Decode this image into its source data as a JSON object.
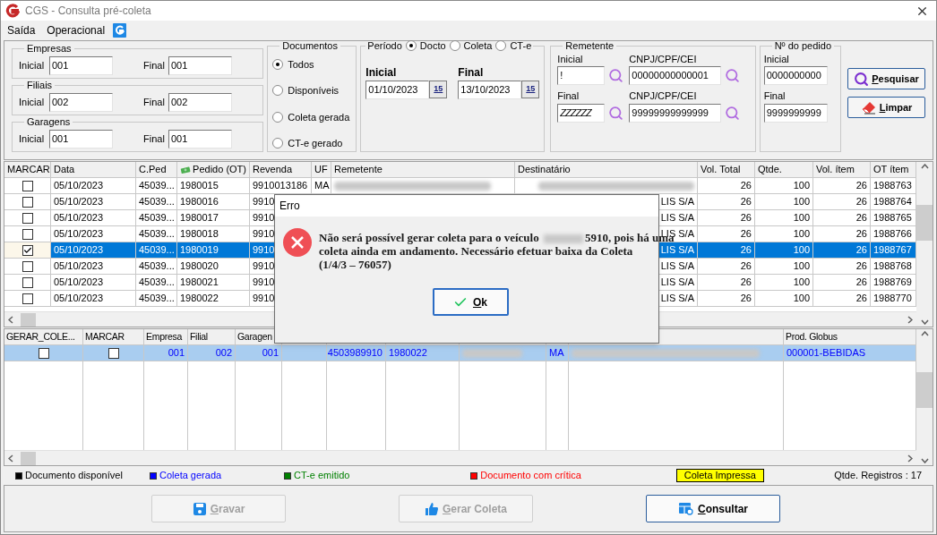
{
  "window": {
    "title": "CGS - Consulta pré-coleta"
  },
  "menu": [
    "Saída",
    "Operacional"
  ],
  "ranges": [
    {
      "label": "Empresas",
      "initial_label": "Inicial",
      "initial": "001",
      "final_label": "Final",
      "final": "001"
    },
    {
      "label": "Filiais",
      "initial_label": "Inicial",
      "initial": "002",
      "final_label": "Final",
      "final": "002"
    },
    {
      "label": "Garagens",
      "initial_label": "Inicial",
      "initial": "001",
      "final_label": "Final",
      "final": "001"
    }
  ],
  "documentos": {
    "label": "Documentos",
    "options": [
      {
        "label": "Todos",
        "selected": true
      },
      {
        "label": "Disponíveis",
        "selected": false
      },
      {
        "label": "Coleta gerada",
        "selected": false
      },
      {
        "label": "CT-e gerado",
        "selected": false
      }
    ]
  },
  "periodo": {
    "label": "Período",
    "options": [
      {
        "label": "Docto",
        "selected": true
      },
      {
        "label": "Coleta",
        "selected": false
      },
      {
        "label": "CT-e",
        "selected": false
      }
    ],
    "dates": [
      {
        "label": "Inicial",
        "value": "01/10/2023",
        "calendar": "15"
      },
      {
        "label": "Final",
        "value": "13/10/2023",
        "calendar": "15"
      }
    ]
  },
  "remetente": {
    "label": "Remetente",
    "rows": [
      {
        "label": "Inicial",
        "value": "!",
        "doc_label": "CNPJ/CPF/CEI",
        "doc": "00000000000001"
      },
      {
        "label": "Final",
        "value": "ZZZZZZ",
        "doc_label": "CNPJ/CPF/CEI",
        "doc": "99999999999999"
      }
    ]
  },
  "pedido": {
    "label": "Nº do pedido",
    "rows": [
      {
        "label": "Inicial",
        "value": "0000000000"
      },
      {
        "label": "Final",
        "value": "9999999999"
      }
    ]
  },
  "actions": [
    {
      "kind": "search",
      "label": "Pesquisar"
    },
    {
      "kind": "clear",
      "label": "Limpar"
    }
  ],
  "table": {
    "columns": [
      "MARCAR",
      "Data",
      "C.Ped",
      "Pedido (OT)",
      "Revenda",
      "UF",
      "Remetente",
      "Destinatário",
      "Vol. Total",
      "Qtde.",
      "Vol. ítem",
      "OT ítem"
    ],
    "rows": [
      {
        "selected": false,
        "cells": [
          {
            "checked": false
          },
          "05/10/2023",
          "45039...",
          "1980015",
          "9910013186",
          "MA",
          {
            "redacted": true
          },
          {
            "redacted": true
          },
          "26",
          "100",
          "26",
          "1988763"
        ]
      },
      {
        "selected": false,
        "cells": [
          {
            "checked": false
          },
          "05/10/2023",
          "45039...",
          "1980016",
          "9910",
          null,
          null,
          "LIS S/A",
          "26",
          "100",
          "26",
          "1988764"
        ]
      },
      {
        "selected": false,
        "cells": [
          {
            "checked": false
          },
          "05/10/2023",
          "45039...",
          "1980017",
          "9910",
          null,
          null,
          "LIS S/A",
          "26",
          "100",
          "26",
          "1988765"
        ]
      },
      {
        "selected": false,
        "cells": [
          {
            "checked": false
          },
          "05/10/2023",
          "45039...",
          "1980018",
          "9910",
          null,
          null,
          "LIS S/A",
          "26",
          "100",
          "26",
          "1988766"
        ]
      },
      {
        "selected": true,
        "cells": [
          {
            "checked": true
          },
          "05/10/2023",
          "45039...",
          "1980019",
          "9910",
          null,
          null,
          "LIS S/A",
          "26",
          "100",
          "26",
          "1988767"
        ]
      },
      {
        "selected": false,
        "cells": [
          {
            "checked": false
          },
          "05/10/2023",
          "45039...",
          "1980020",
          "9910",
          null,
          null,
          "LIS S/A",
          "26",
          "100",
          "26",
          "1988768"
        ]
      },
      {
        "selected": false,
        "cells": [
          {
            "checked": false
          },
          "05/10/2023",
          "45039...",
          "1980021",
          "9910",
          null,
          null,
          "LIS S/A",
          "26",
          "100",
          "26",
          "1988769"
        ]
      },
      {
        "selected": false,
        "cells": [
          {
            "checked": false
          },
          "05/10/2023",
          "45039...",
          "1980022",
          "9910",
          null,
          null,
          "LIS S/A",
          "26",
          "100",
          "26",
          "1988770"
        ]
      }
    ]
  },
  "table2": {
    "columns": [
      "GERAR_COLE...",
      "MARCAR",
      "Empresa",
      "Filial",
      "Garagen",
      null,
      null,
      null,
      null,
      null,
      null,
      "Prod. Globus"
    ],
    "rows": [
      {
        "selected": true,
        "cells": [
          {
            "checked": false
          },
          {
            "checked": false
          },
          "001",
          "002",
          "001",
          null,
          "4503989910",
          "1980022",
          {
            "redacted": true
          },
          "MA",
          {
            "redacted": true
          },
          "000001-BEBIDAS"
        ]
      }
    ]
  },
  "legend": [
    {
      "label": "Documento disponível",
      "color": "#000000",
      "highlight": false
    },
    {
      "label": "Coleta gerada",
      "color": "#0000ff",
      "highlight": false
    },
    {
      "label": "CT-e emitido",
      "color": "#008000",
      "highlight": false
    },
    {
      "label": "Documento com crítica",
      "color": "#ff0000",
      "highlight": false
    },
    {
      "label": "Coleta Impressa",
      "color": "#ffff00",
      "highlight": true
    }
  ],
  "record_count": "Qtde. Registros : 17",
  "buttons": [
    {
      "kind": "save",
      "label": "Gravar",
      "disabled": true
    },
    {
      "kind": "generate",
      "label": "Gerar Coleta",
      "disabled": true
    },
    {
      "kind": "query",
      "label": "Consultar",
      "disabled": false
    }
  ],
  "dialog": {
    "title": "Erro",
    "lines": [
      {
        "before": "Não será possível gerar coleta para o veículo ",
        "redacted": true,
        "after": "5910, pois há uma"
      },
      {
        "before": "coleta ainda em andamento. Necessário efetuar baixa da Coleta",
        "redacted": false
      },
      {
        "before": "(1/4/3 – 76057)",
        "redacted": false
      }
    ],
    "button": "Ok"
  }
}
